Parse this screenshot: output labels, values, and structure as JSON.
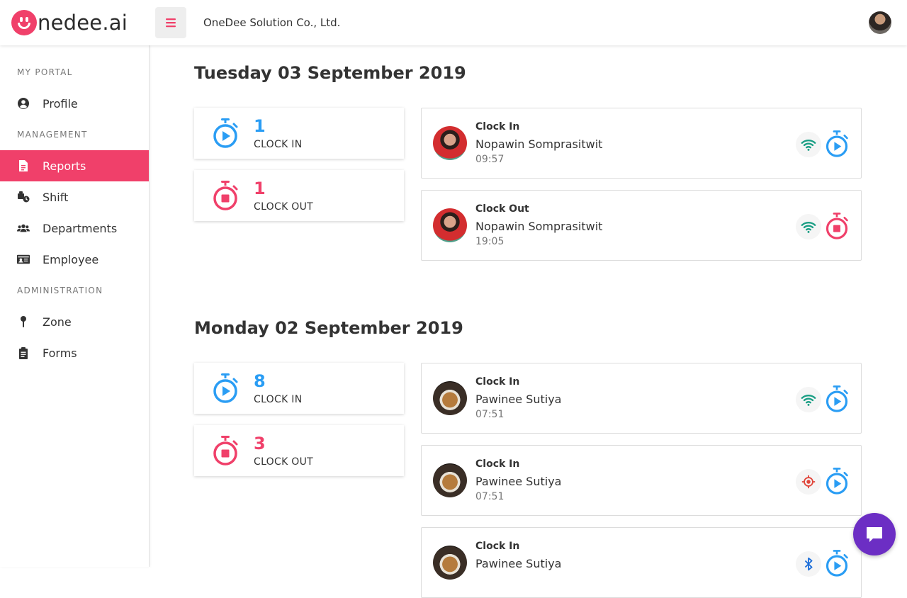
{
  "header": {
    "logo_text": "nedee.ai",
    "company": "OneDee Solution Co., Ltd."
  },
  "sidebar": {
    "sections": [
      "MY PORTAL",
      "MANAGEMENT",
      "ADMINISTRATION"
    ],
    "items": [
      {
        "label": "Profile",
        "icon": "user-circle-icon",
        "active": false
      },
      {
        "label": "Reports",
        "icon": "file-icon",
        "active": true
      },
      {
        "label": "Shift",
        "icon": "shift-icon",
        "active": false
      },
      {
        "label": "Departments",
        "icon": "users-icon",
        "active": false
      },
      {
        "label": "Employee",
        "icon": "id-card-icon",
        "active": false
      },
      {
        "label": "Zone",
        "icon": "map-pin-icon",
        "active": false
      },
      {
        "label": "Forms",
        "icon": "clipboard-icon",
        "active": false
      }
    ]
  },
  "days": [
    {
      "title": "Tuesday 03 September 2019",
      "clock_in_count": "1",
      "clock_in_label": "CLOCK IN",
      "clock_out_count": "1",
      "clock_out_label": "CLOCK OUT",
      "entries": [
        {
          "type": "Clock In",
          "name": "Nopawin Somprasitwit",
          "time": "09:57",
          "source": "wifi-icon"
        },
        {
          "type": "Clock Out",
          "name": "Nopawin Somprasitwit",
          "time": "19:05",
          "source": "wifi-icon"
        }
      ]
    },
    {
      "title": "Monday 02 September 2019",
      "clock_in_count": "8",
      "clock_in_label": "CLOCK IN",
      "clock_out_count": "3",
      "clock_out_label": "CLOCK OUT",
      "entries": [
        {
          "type": "Clock In",
          "name": "Pawinee Sutiya",
          "time": "07:51",
          "source": "wifi-icon"
        },
        {
          "type": "Clock In",
          "name": "Pawinee Sutiya",
          "time": "07:51",
          "source": "gps-target-icon"
        },
        {
          "type": "Clock In",
          "name": "Pawinee Sutiya",
          "time": "",
          "source": "bluetooth-icon"
        }
      ]
    }
  ],
  "colors": {
    "accent": "#f0406a",
    "clock_in": "#2a9df4",
    "wifi": "#1a9e84",
    "gps": "#e0453a",
    "bluetooth": "#1e6fd9",
    "chat": "#6c2ec4"
  }
}
